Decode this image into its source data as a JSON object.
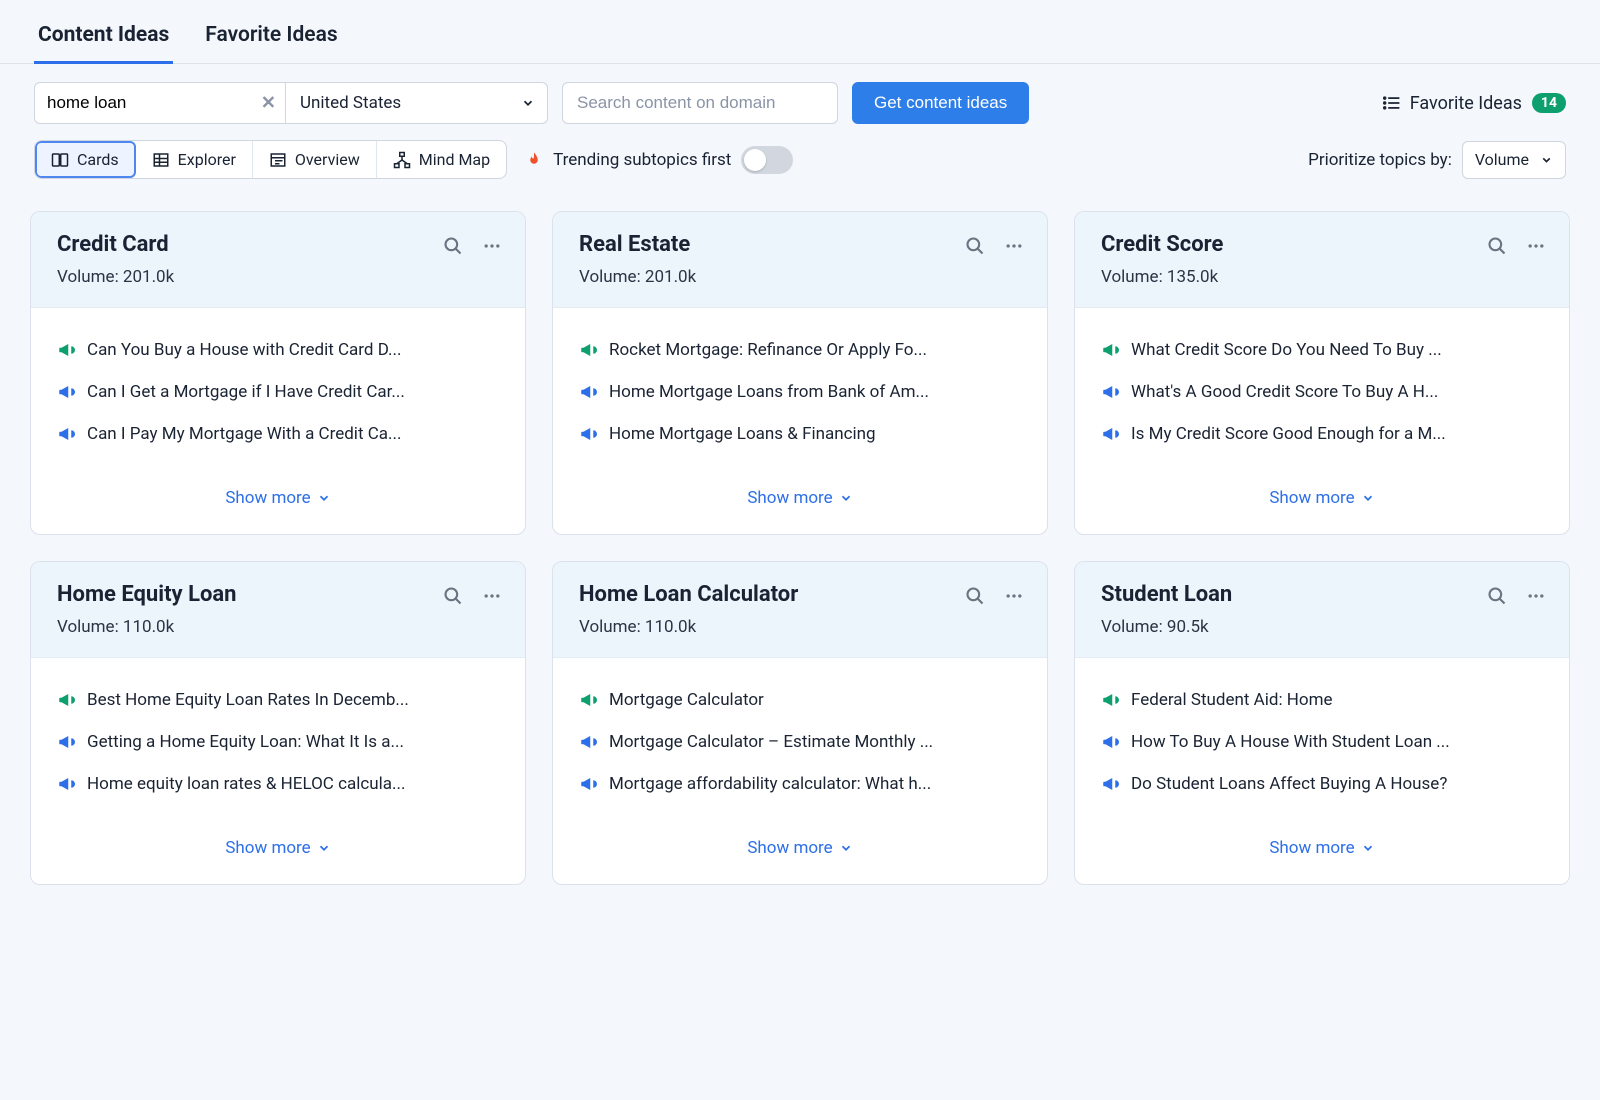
{
  "tabs": {
    "content_ideas": "Content Ideas",
    "favorite_ideas": "Favorite Ideas"
  },
  "filters": {
    "keyword_value": "home loan",
    "country_value": "United States",
    "search_placeholder": "Search content on domain",
    "get_ideas_label": "Get content ideas"
  },
  "fav_link": {
    "label": "Favorite Ideas",
    "count": "14"
  },
  "view_modes": {
    "cards": "Cards",
    "explorer": "Explorer",
    "overview": "Overview",
    "mindmap": "Mind Map"
  },
  "trending_label": "Trending subtopics first",
  "prioritize": {
    "label": "Prioritize topics by:",
    "value": "Volume"
  },
  "show_more_label": "Show more",
  "cards": [
    {
      "title": "Credit Card",
      "volume": "Volume: 201.0k",
      "items": [
        {
          "color": "green",
          "text": "Can You Buy a House with Credit Card D..."
        },
        {
          "color": "blue",
          "text": "Can I Get a Mortgage if I Have Credit Car..."
        },
        {
          "color": "blue",
          "text": "Can I Pay My Mortgage With a Credit Ca..."
        }
      ]
    },
    {
      "title": "Real Estate",
      "volume": "Volume: 201.0k",
      "items": [
        {
          "color": "green",
          "text": "Rocket Mortgage: Refinance Or Apply Fo..."
        },
        {
          "color": "blue",
          "text": "Home Mortgage Loans from Bank of Am..."
        },
        {
          "color": "blue",
          "text": "Home Mortgage Loans & Financing"
        }
      ]
    },
    {
      "title": "Credit Score",
      "volume": "Volume: 135.0k",
      "items": [
        {
          "color": "green",
          "text": "What Credit Score Do You Need To Buy ..."
        },
        {
          "color": "blue",
          "text": "What's A Good Credit Score To Buy A H..."
        },
        {
          "color": "blue",
          "text": "Is My Credit Score Good Enough for a M..."
        }
      ]
    },
    {
      "title": "Home Equity Loan",
      "volume": "Volume: 110.0k",
      "items": [
        {
          "color": "green",
          "text": "Best Home Equity Loan Rates In Decemb..."
        },
        {
          "color": "blue",
          "text": "Getting a Home Equity Loan: What It Is a..."
        },
        {
          "color": "blue",
          "text": "Home equity loan rates & HELOC calcula..."
        }
      ]
    },
    {
      "title": "Home Loan Calculator",
      "volume": "Volume: 110.0k",
      "items": [
        {
          "color": "green",
          "text": "Mortgage Calculator"
        },
        {
          "color": "blue",
          "text": "Mortgage Calculator – Estimate Monthly ..."
        },
        {
          "color": "blue",
          "text": "Mortgage affordability calculator: What h..."
        }
      ]
    },
    {
      "title": "Student Loan",
      "volume": "Volume: 90.5k",
      "items": [
        {
          "color": "green",
          "text": "Federal Student Aid: Home"
        },
        {
          "color": "blue",
          "text": "How To Buy A House With Student Loan ..."
        },
        {
          "color": "blue",
          "text": "Do Student Loans Affect Buying A House?"
        }
      ]
    }
  ]
}
